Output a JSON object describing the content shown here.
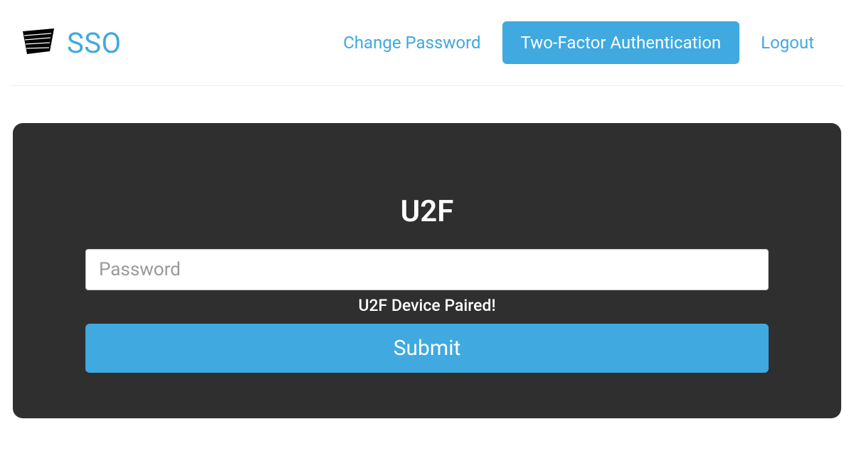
{
  "brand": {
    "title": "SSO"
  },
  "nav": {
    "change_password": "Change Password",
    "two_factor": "Two-Factor Authentication",
    "logout": "Logout"
  },
  "panel": {
    "title": "U2F",
    "password_placeholder": "Password",
    "password_value": "",
    "status": "U2F Device Paired!",
    "submit_label": "Submit"
  },
  "colors": {
    "accent": "#3fa9e0",
    "panel_bg": "#2f2f2f"
  }
}
